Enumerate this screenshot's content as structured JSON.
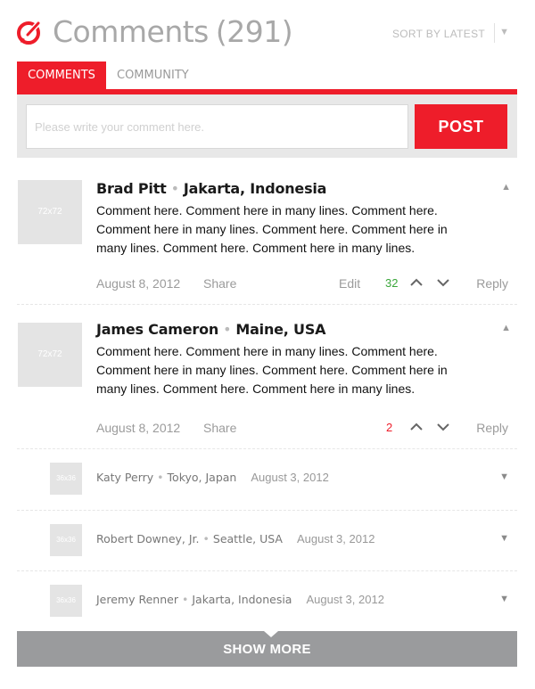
{
  "header": {
    "title": "Comments",
    "count": "(291)",
    "sort_label": "SORT BY LATEST"
  },
  "tabs": [
    {
      "label": "COMMENTS"
    },
    {
      "label": "COMMUNITY"
    }
  ],
  "composer": {
    "placeholder": "Please write your comment here.",
    "value": "",
    "post_label": "POST"
  },
  "comments": [
    {
      "avatar_text": "72x72",
      "name": "Brad Pitt",
      "location": "Jakarta, Indonesia",
      "body": "Comment here. Comment here in many lines. Comment here. Comment here in many lines. Comment here. Comment here in many lines. Comment here. Comment here in many lines.",
      "date": "August 8, 2012",
      "share_label": "Share",
      "edit_label": "Edit",
      "votes": "32",
      "reply_label": "Reply"
    },
    {
      "avatar_text": "72x72",
      "name": "James Cameron",
      "location": "Maine, USA",
      "body": "Comment here. Comment here in many lines. Comment here. Comment here in many lines. Comment here. Comment here in many lines. Comment here. Comment here in many lines.",
      "date": "August 8, 2012",
      "share_label": "Share",
      "votes": "2",
      "reply_label": "Reply"
    }
  ],
  "replies": [
    {
      "avatar_text": "36x36",
      "name": "Katy Perry",
      "location": "Tokyo, Japan",
      "date": "August 3, 2012"
    },
    {
      "avatar_text": "36x36",
      "name": "Robert Downey, Jr.",
      "location": "Seattle, USA",
      "date": "August 3, 2012"
    },
    {
      "avatar_text": "36x36",
      "name": "Jeremy Renner",
      "location": "Jakarta, Indonesia",
      "date": "August 3, 2012"
    }
  ],
  "show_more_label": "SHOW MORE",
  "colors": {
    "accent": "#ee1d2a",
    "positive_votes": "#3aa63a",
    "button_gray": "#9a9b9d"
  },
  "icons": {
    "logo": "comment-logo-icon",
    "sort_caret": "caret-down-icon",
    "collapse": "triangle-up-icon",
    "expand": "triangle-down-icon",
    "upvote": "chevron-up-icon",
    "downvote": "chevron-down-icon"
  }
}
